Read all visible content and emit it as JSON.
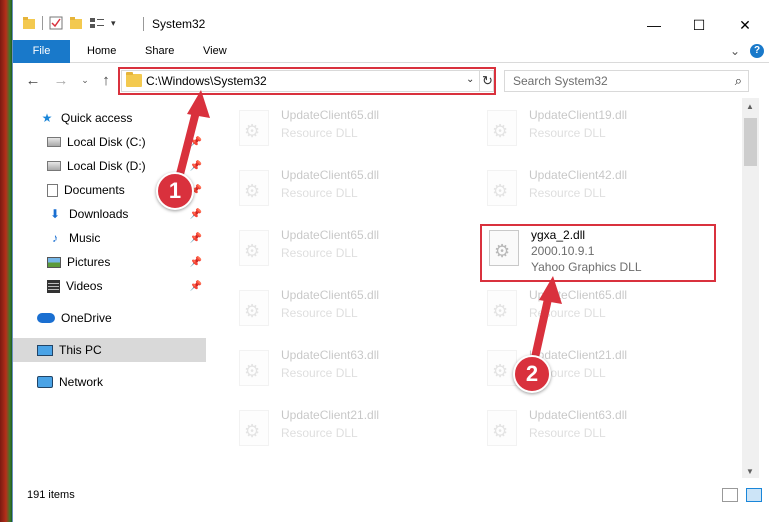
{
  "window": {
    "title": "System32",
    "controls": {
      "minimize": "—",
      "maximize": "☐",
      "close": "✕"
    }
  },
  "ribbon": {
    "tabs": [
      "File",
      "Home",
      "Share",
      "View"
    ],
    "expand_glyph": "⌄",
    "help_glyph": "?"
  },
  "nav": {
    "back": "←",
    "forward": "→",
    "recent": "⌄",
    "up": "↑",
    "address_path": "C:\\Windows\\System32",
    "address_dropdown": "⌄",
    "refresh": "↻",
    "search_placeholder": "Search System32",
    "search_icon": "⌕"
  },
  "sidebar": {
    "items": [
      {
        "label": "Quick access",
        "icon": "star-icon"
      },
      {
        "label": "Local Disk (C:)",
        "icon": "drive-icon",
        "pinned": true
      },
      {
        "label": "Local Disk (D:)",
        "icon": "drive-icon",
        "pinned": true
      },
      {
        "label": "Documents",
        "icon": "document-icon",
        "pinned": true
      },
      {
        "label": "Downloads",
        "icon": "download-icon",
        "pinned": true
      },
      {
        "label": "Music",
        "icon": "music-icon",
        "pinned": true
      },
      {
        "label": "Pictures",
        "icon": "pictures-icon",
        "pinned": true
      },
      {
        "label": "Videos",
        "icon": "videos-icon",
        "pinned": true
      },
      {
        "label": "OneDrive",
        "icon": "onedrive-icon"
      },
      {
        "label": "This PC",
        "icon": "computer-icon",
        "selected": true
      },
      {
        "label": "Network",
        "icon": "network-icon"
      }
    ],
    "pin_glyph": "📌"
  },
  "files": {
    "left_column": [
      {
        "name": "UpdateClient65.dll",
        "desc": "Resource DLL"
      },
      {
        "name": "UpdateClient65.dll",
        "desc": "Resource DLL"
      },
      {
        "name": "UpdateClient65.dll",
        "desc": "Resource DLL"
      },
      {
        "name": "UpdateClient65.dll",
        "desc": "Resource DLL"
      },
      {
        "name": "UpdateClient63.dll",
        "desc": "Resource DLL"
      },
      {
        "name": "UpdateClient21.dll",
        "desc": "Resource DLL"
      }
    ],
    "right_column": [
      {
        "name": "UpdateClient19.dll",
        "desc": "Resource DLL"
      },
      {
        "name": "UpdateClient42.dll",
        "desc": "Resource DLL"
      },
      {
        "name": "UpdateClient65.dll",
        "desc": "Resource DLL"
      },
      {
        "name": "UpdateClient21.dll",
        "desc": "Resource DLL"
      },
      {
        "name": "UpdateClient63.dll",
        "desc": "Resource DLL"
      }
    ],
    "highlighted": {
      "name": "ygxa_2.dll",
      "version": "2000.10.9.1",
      "desc": "Yahoo Graphics DLL"
    }
  },
  "scrollbar": {
    "up": "▲",
    "down": "▼"
  },
  "status": {
    "item_count": "191 items"
  },
  "annotations": {
    "step1": "1",
    "step2": "2"
  },
  "colors": {
    "accent": "#1979ca",
    "highlight": "#d9313d"
  }
}
